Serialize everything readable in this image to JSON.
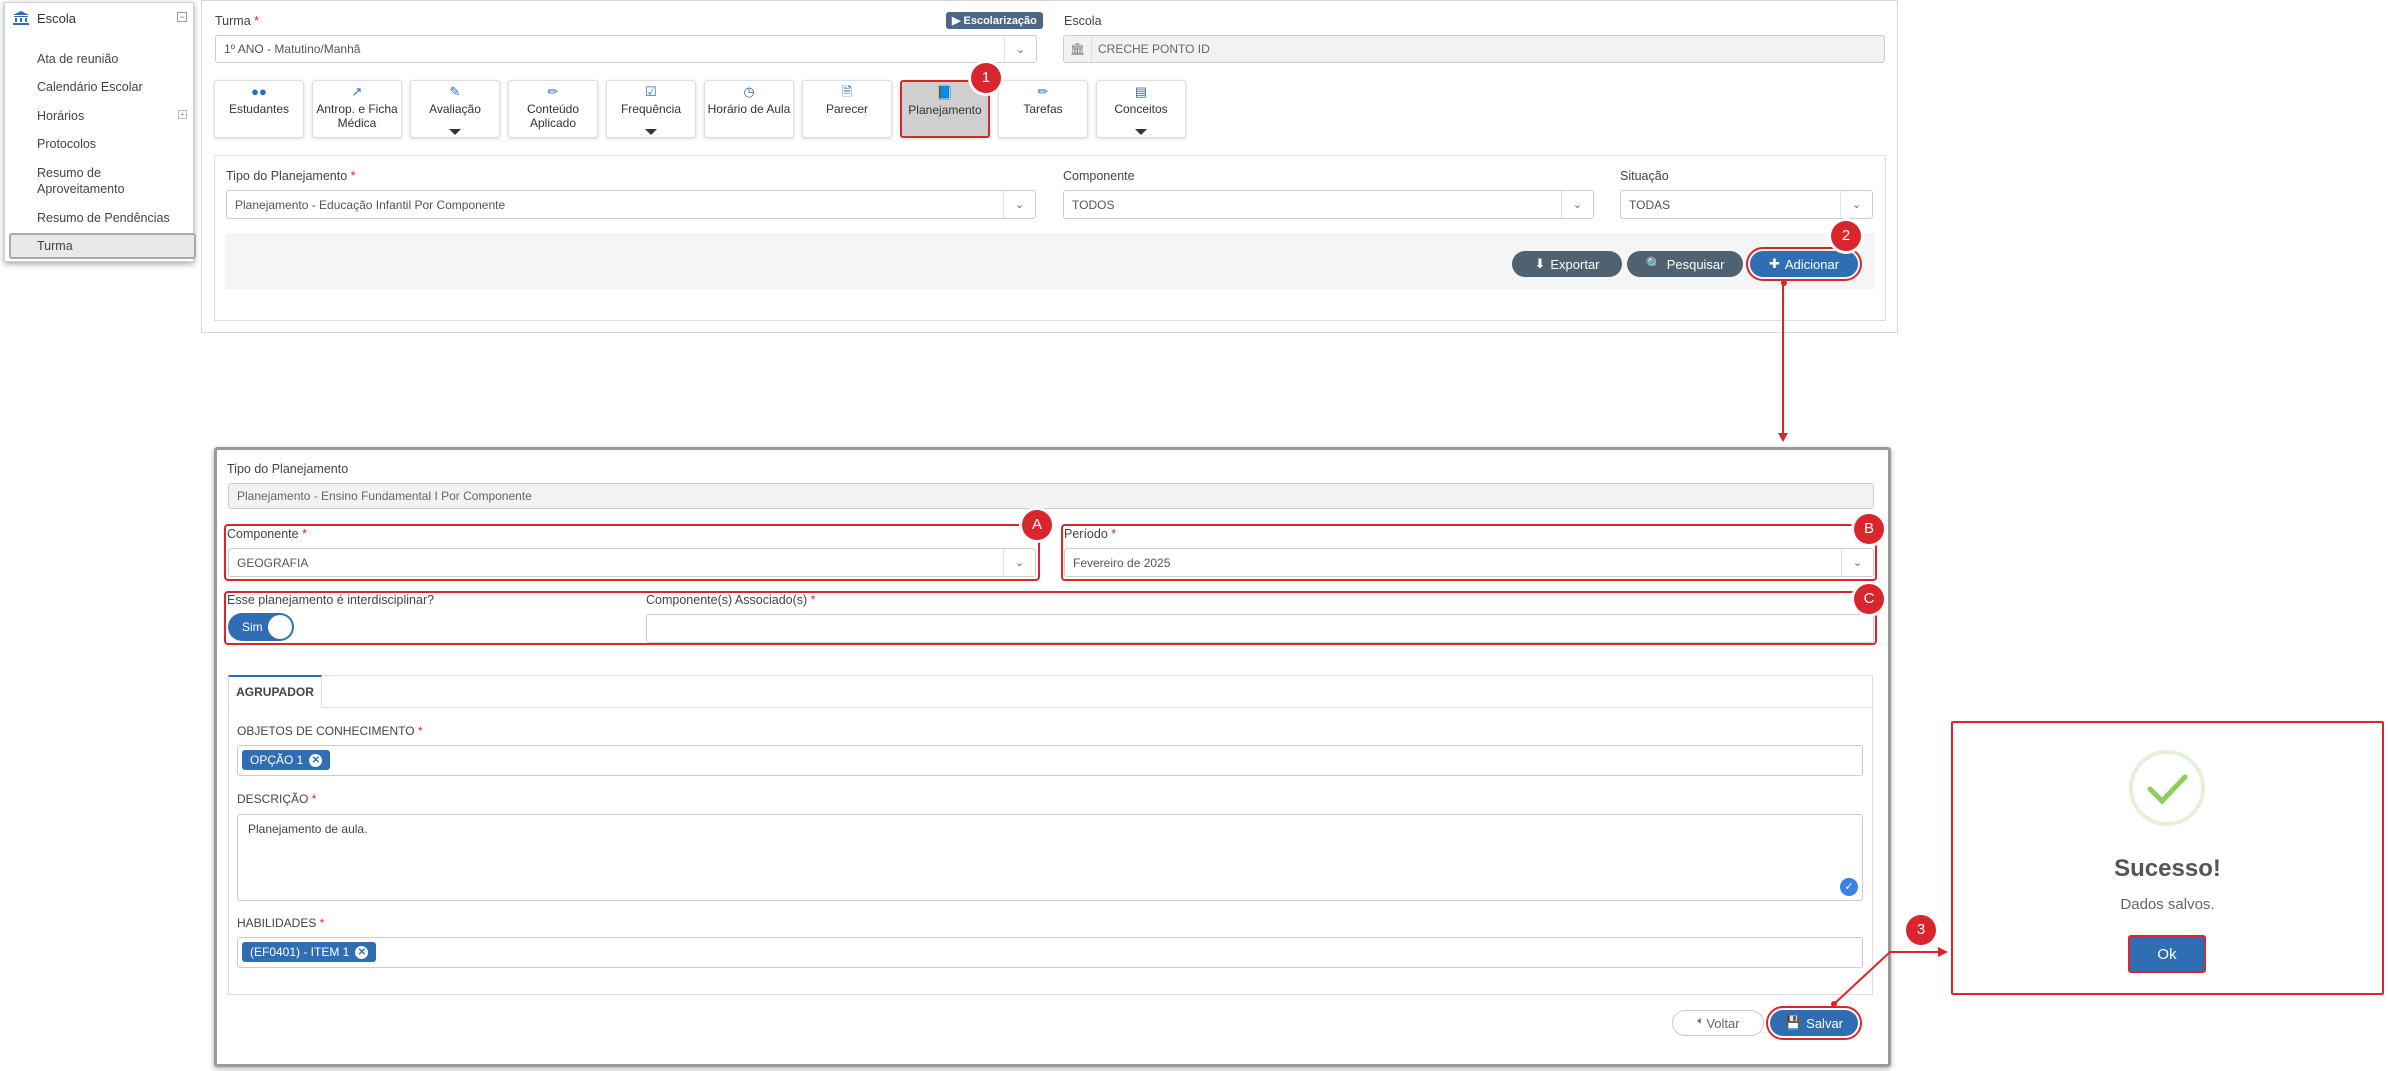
{
  "sidebar": {
    "title": "Escola",
    "items": [
      "Ata de reunião",
      "Calendário Escolar",
      "Horários",
      "Protocolos",
      "Resumo de Aproveitamento",
      "Resumo de Pendências",
      "Turma"
    ],
    "active": "Turma"
  },
  "top": {
    "turma_label": "Turma",
    "turma_value": "1º ANO - Matutino/Manhã",
    "escolarizacao_badge": "Escolarização",
    "escola_label": "Escola",
    "escola_value": "CRECHE PONTO ID",
    "tabs": [
      {
        "label": "Estudantes",
        "icon": "users-icon"
      },
      {
        "label": "Antrop. e Ficha Médica",
        "icon": "chart-line-icon"
      },
      {
        "label": "Avaliação",
        "icon": "edit-icon"
      },
      {
        "label": "Conteúdo Aplicado",
        "icon": "pencil-icon"
      },
      {
        "label": "Frequência",
        "icon": "check-square-icon"
      },
      {
        "label": "Horário de Aula",
        "icon": "clock-icon"
      },
      {
        "label": "Parecer",
        "icon": "file-icon"
      },
      {
        "label": "Planejamento",
        "icon": "book-icon"
      },
      {
        "label": "Tarefas",
        "icon": "pencil-icon"
      },
      {
        "label": "Conceitos",
        "icon": "list-icon"
      }
    ],
    "tipo_label": "Tipo do Planejamento",
    "tipo_value": "Planejamento - Educação Infantil Por Componente",
    "componente_label": "Componente",
    "componente_value": "TODOS",
    "situacao_label": "Situação",
    "situacao_value": "TODAS",
    "btn_exportar": "Exportar",
    "btn_pesquisar": "Pesquisar",
    "btn_adicionar": "Adicionar"
  },
  "form": {
    "tipo_label": "Tipo do Planejamento",
    "tipo_value": "Planejamento - Ensino Fundamental I Por Componente",
    "componente_label": "Componente",
    "componente_value": "GEOGRAFIA",
    "periodo_label": "Período",
    "periodo_value": "Fevereiro de 2025",
    "interdisciplinar_label": "Esse planejamento é interdisciplinar?",
    "toggle_value": "Sim",
    "associados_label": "Componente(s) Associado(s)",
    "tab_agrupador": "AGRUPADOR",
    "objetos_label": "OBJETOS DE CONHECIMENTO",
    "objetos_tag": "OPÇÃO 1",
    "descricao_label": "DESCRIÇÃO",
    "descricao_value": "Planejamento de aula.",
    "habilidades_label": "HABILIDADES",
    "habilidades_tag": "(EF0401) - ITEM 1",
    "btn_voltar": "Voltar",
    "btn_salvar": "Salvar"
  },
  "modal": {
    "title": "Sucesso!",
    "message": "Dados salvos.",
    "ok": "Ok"
  },
  "callouts": [
    "1",
    "2",
    "3",
    "A",
    "B",
    "C"
  ],
  "colors": {
    "accent": "#2f6eb3",
    "callout": "#d9262c",
    "dark_button": "#4f6271"
  }
}
